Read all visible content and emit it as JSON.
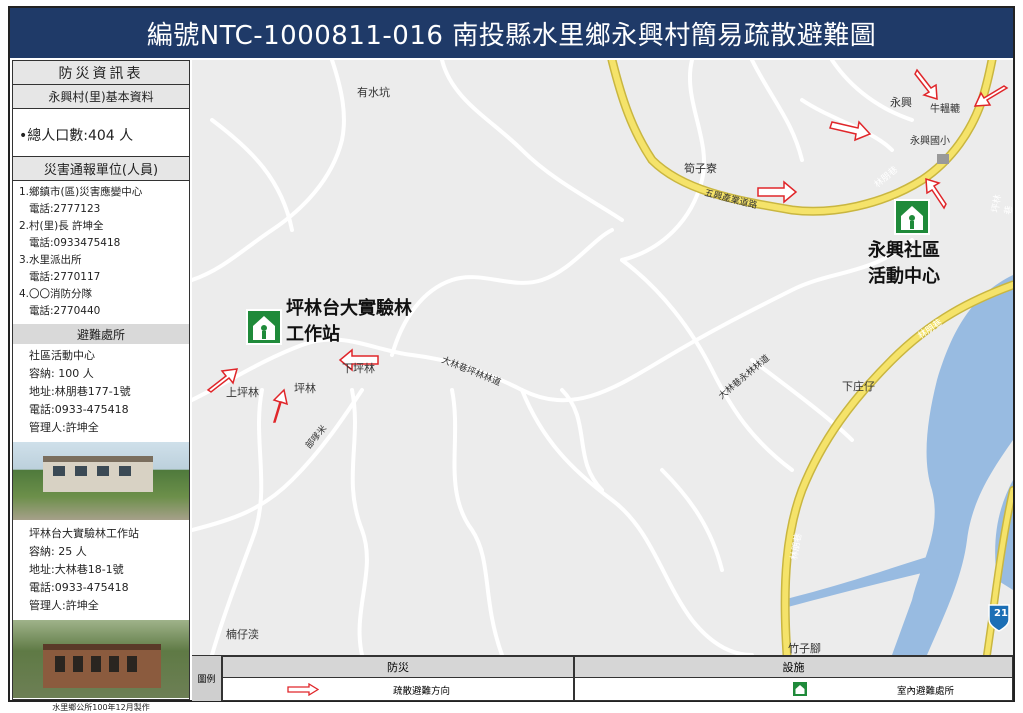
{
  "title": "編號NTC-1000811-016  南投縣水里鄉永興村簡易疏散避難圖",
  "sidebar": {
    "header": "防災資訊表",
    "basic_info": "永興村(里)基本資料",
    "population": "•總人口數:404  人",
    "contact_header": "災害通報單位(人員)",
    "contacts": [
      {
        "name": "1.鄉鎮市(區)災害應變中心",
        "tel": "電話:2777123"
      },
      {
        "name": "2.村(里)長  許坤全",
        "tel": "電話:0933475418"
      },
      {
        "name": "3.水里派出所",
        "tel": "電話:2770117"
      },
      {
        "name": "4.〇〇消防分隊",
        "tel": "電話:2770440"
      }
    ],
    "shelter_header": "避難處所",
    "shelters": [
      {
        "name": "社區活動中心",
        "capacity": "容納:  100  人",
        "address": "地址:林朋巷177-1號",
        "phone": "電話:0933-475418",
        "manager": "管理人:許坤全"
      },
      {
        "name": "坪林台大實驗林工作站",
        "capacity": "容納:    25  人",
        "address": "地址:大林巷18-1號",
        "phone": "電話:0933-475418",
        "manager": "管理人:許坤全"
      }
    ],
    "credit": "水里鄉公所100年12月製作"
  },
  "map": {
    "shelter_labels": [
      {
        "line1": "坪林台大實驗林",
        "line2": "工作站"
      },
      {
        "line1": "永興社區",
        "line2": "活動中心"
      }
    ],
    "place_names": [
      "有水坑",
      "永興",
      "牛轀轆",
      "永興國小",
      "筍子寮",
      "五興產業道路",
      "林朋巷",
      "大林巷坪林林道",
      "大林巷永林林道",
      "上坪林",
      "坪林",
      "下坪林",
      "部嗲米",
      "下庄仔",
      "楠仔湙",
      "竹子腳",
      "林朋巷",
      "坪林巷",
      "林朋巷",
      "21"
    ],
    "colors": {
      "road_main": "#f5e36a",
      "road": "#ffffff",
      "river": "#8fb6e0",
      "arrow": "#e0262a",
      "shelter": "#1f8a3a"
    }
  },
  "legend": {
    "label": "圖例",
    "col1_header": "防災",
    "col2_header": "設施",
    "item1": "疏散避難方向",
    "item2": "室內避難處所"
  }
}
